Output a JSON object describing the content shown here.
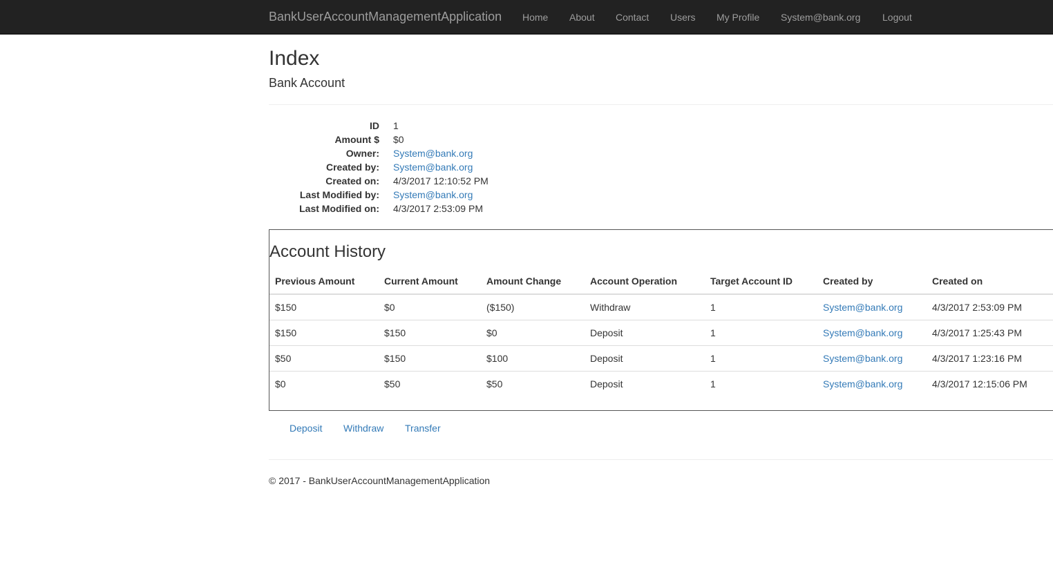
{
  "navbar": {
    "brand": "BankUserAccountManagementApplication",
    "items": [
      {
        "label": "Home"
      },
      {
        "label": "About"
      },
      {
        "label": "Contact"
      },
      {
        "label": "Users"
      },
      {
        "label": "My Profile"
      },
      {
        "label": "System@bank.org"
      },
      {
        "label": "Logout"
      }
    ]
  },
  "page": {
    "title": "Index",
    "subtitle": "Bank Account"
  },
  "details": [
    {
      "label": "ID",
      "value": "1"
    },
    {
      "label": "Amount $",
      "value": "$0"
    },
    {
      "label": "Owner:",
      "value": "System@bank.org"
    },
    {
      "label": "Created by:",
      "value": "System@bank.org"
    },
    {
      "label": "Created on:",
      "value": "4/3/2017 12:10:52 PM"
    },
    {
      "label": "Last Modified by:",
      "value": "System@bank.org"
    },
    {
      "label": "Last Modified on:",
      "value": "4/3/2017 2:53:09 PM"
    }
  ],
  "history": {
    "title": "Account History",
    "columns": [
      "Previous Amount",
      "Current Amount",
      "Amount Change",
      "Account Operation",
      "Target Account ID",
      "Created by",
      "Created on"
    ],
    "rows": [
      [
        "$150",
        "$0",
        "($150)",
        "Withdraw",
        "1",
        "System@bank.org",
        "4/3/2017 2:53:09 PM"
      ],
      [
        "$150",
        "$150",
        "$0",
        "Deposit",
        "1",
        "System@bank.org",
        "4/3/2017 1:25:43 PM"
      ],
      [
        "$50",
        "$150",
        "$100",
        "Deposit",
        "1",
        "System@bank.org",
        "4/3/2017 1:23:16 PM"
      ],
      [
        "$0",
        "$50",
        "$50",
        "Deposit",
        "1",
        "System@bank.org",
        "4/3/2017 12:15:06 PM"
      ]
    ]
  },
  "actions": {
    "deposit": "Deposit",
    "withdraw": "Withdraw",
    "transfer": "Transfer"
  },
  "footer": {
    "text": "© 2017 - BankUserAccountManagementApplication"
  },
  "colors": {
    "navbar_bg": "#222222",
    "navbar_text": "#9d9d9d",
    "link": "#337ab7"
  }
}
